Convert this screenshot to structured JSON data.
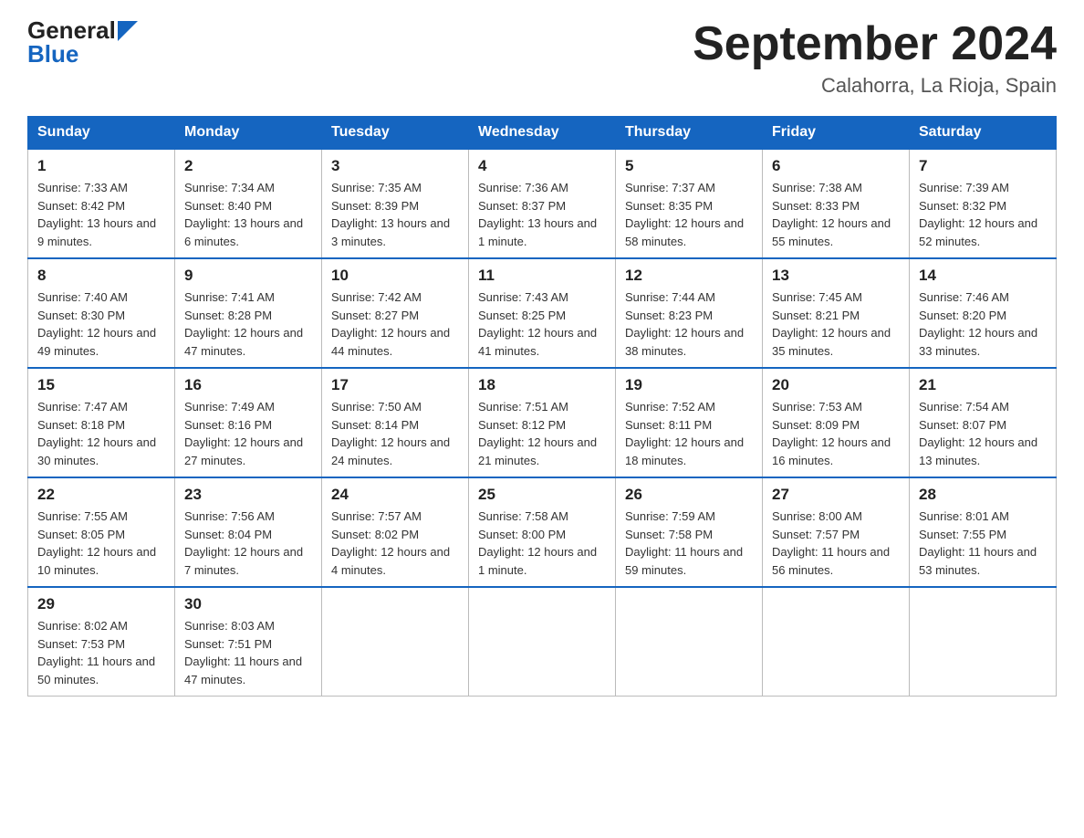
{
  "header": {
    "logo_general": "General",
    "logo_blue": "Blue",
    "title": "September 2024",
    "subtitle": "Calahorra, La Rioja, Spain"
  },
  "days_of_week": [
    "Sunday",
    "Monday",
    "Tuesday",
    "Wednesday",
    "Thursday",
    "Friday",
    "Saturday"
  ],
  "weeks": [
    [
      {
        "day": "1",
        "sunrise": "7:33 AM",
        "sunset": "8:42 PM",
        "daylight": "13 hours and 9 minutes."
      },
      {
        "day": "2",
        "sunrise": "7:34 AM",
        "sunset": "8:40 PM",
        "daylight": "13 hours and 6 minutes."
      },
      {
        "day": "3",
        "sunrise": "7:35 AM",
        "sunset": "8:39 PM",
        "daylight": "13 hours and 3 minutes."
      },
      {
        "day": "4",
        "sunrise": "7:36 AM",
        "sunset": "8:37 PM",
        "daylight": "13 hours and 1 minute."
      },
      {
        "day": "5",
        "sunrise": "7:37 AM",
        "sunset": "8:35 PM",
        "daylight": "12 hours and 58 minutes."
      },
      {
        "day": "6",
        "sunrise": "7:38 AM",
        "sunset": "8:33 PM",
        "daylight": "12 hours and 55 minutes."
      },
      {
        "day": "7",
        "sunrise": "7:39 AM",
        "sunset": "8:32 PM",
        "daylight": "12 hours and 52 minutes."
      }
    ],
    [
      {
        "day": "8",
        "sunrise": "7:40 AM",
        "sunset": "8:30 PM",
        "daylight": "12 hours and 49 minutes."
      },
      {
        "day": "9",
        "sunrise": "7:41 AM",
        "sunset": "8:28 PM",
        "daylight": "12 hours and 47 minutes."
      },
      {
        "day": "10",
        "sunrise": "7:42 AM",
        "sunset": "8:27 PM",
        "daylight": "12 hours and 44 minutes."
      },
      {
        "day": "11",
        "sunrise": "7:43 AM",
        "sunset": "8:25 PM",
        "daylight": "12 hours and 41 minutes."
      },
      {
        "day": "12",
        "sunrise": "7:44 AM",
        "sunset": "8:23 PM",
        "daylight": "12 hours and 38 minutes."
      },
      {
        "day": "13",
        "sunrise": "7:45 AM",
        "sunset": "8:21 PM",
        "daylight": "12 hours and 35 minutes."
      },
      {
        "day": "14",
        "sunrise": "7:46 AM",
        "sunset": "8:20 PM",
        "daylight": "12 hours and 33 minutes."
      }
    ],
    [
      {
        "day": "15",
        "sunrise": "7:47 AM",
        "sunset": "8:18 PM",
        "daylight": "12 hours and 30 minutes."
      },
      {
        "day": "16",
        "sunrise": "7:49 AM",
        "sunset": "8:16 PM",
        "daylight": "12 hours and 27 minutes."
      },
      {
        "day": "17",
        "sunrise": "7:50 AM",
        "sunset": "8:14 PM",
        "daylight": "12 hours and 24 minutes."
      },
      {
        "day": "18",
        "sunrise": "7:51 AM",
        "sunset": "8:12 PM",
        "daylight": "12 hours and 21 minutes."
      },
      {
        "day": "19",
        "sunrise": "7:52 AM",
        "sunset": "8:11 PM",
        "daylight": "12 hours and 18 minutes."
      },
      {
        "day": "20",
        "sunrise": "7:53 AM",
        "sunset": "8:09 PM",
        "daylight": "12 hours and 16 minutes."
      },
      {
        "day": "21",
        "sunrise": "7:54 AM",
        "sunset": "8:07 PM",
        "daylight": "12 hours and 13 minutes."
      }
    ],
    [
      {
        "day": "22",
        "sunrise": "7:55 AM",
        "sunset": "8:05 PM",
        "daylight": "12 hours and 10 minutes."
      },
      {
        "day": "23",
        "sunrise": "7:56 AM",
        "sunset": "8:04 PM",
        "daylight": "12 hours and 7 minutes."
      },
      {
        "day": "24",
        "sunrise": "7:57 AM",
        "sunset": "8:02 PM",
        "daylight": "12 hours and 4 minutes."
      },
      {
        "day": "25",
        "sunrise": "7:58 AM",
        "sunset": "8:00 PM",
        "daylight": "12 hours and 1 minute."
      },
      {
        "day": "26",
        "sunrise": "7:59 AM",
        "sunset": "7:58 PM",
        "daylight": "11 hours and 59 minutes."
      },
      {
        "day": "27",
        "sunrise": "8:00 AM",
        "sunset": "7:57 PM",
        "daylight": "11 hours and 56 minutes."
      },
      {
        "day": "28",
        "sunrise": "8:01 AM",
        "sunset": "7:55 PM",
        "daylight": "11 hours and 53 minutes."
      }
    ],
    [
      {
        "day": "29",
        "sunrise": "8:02 AM",
        "sunset": "7:53 PM",
        "daylight": "11 hours and 50 minutes."
      },
      {
        "day": "30",
        "sunrise": "8:03 AM",
        "sunset": "7:51 PM",
        "daylight": "11 hours and 47 minutes."
      },
      null,
      null,
      null,
      null,
      null
    ]
  ]
}
